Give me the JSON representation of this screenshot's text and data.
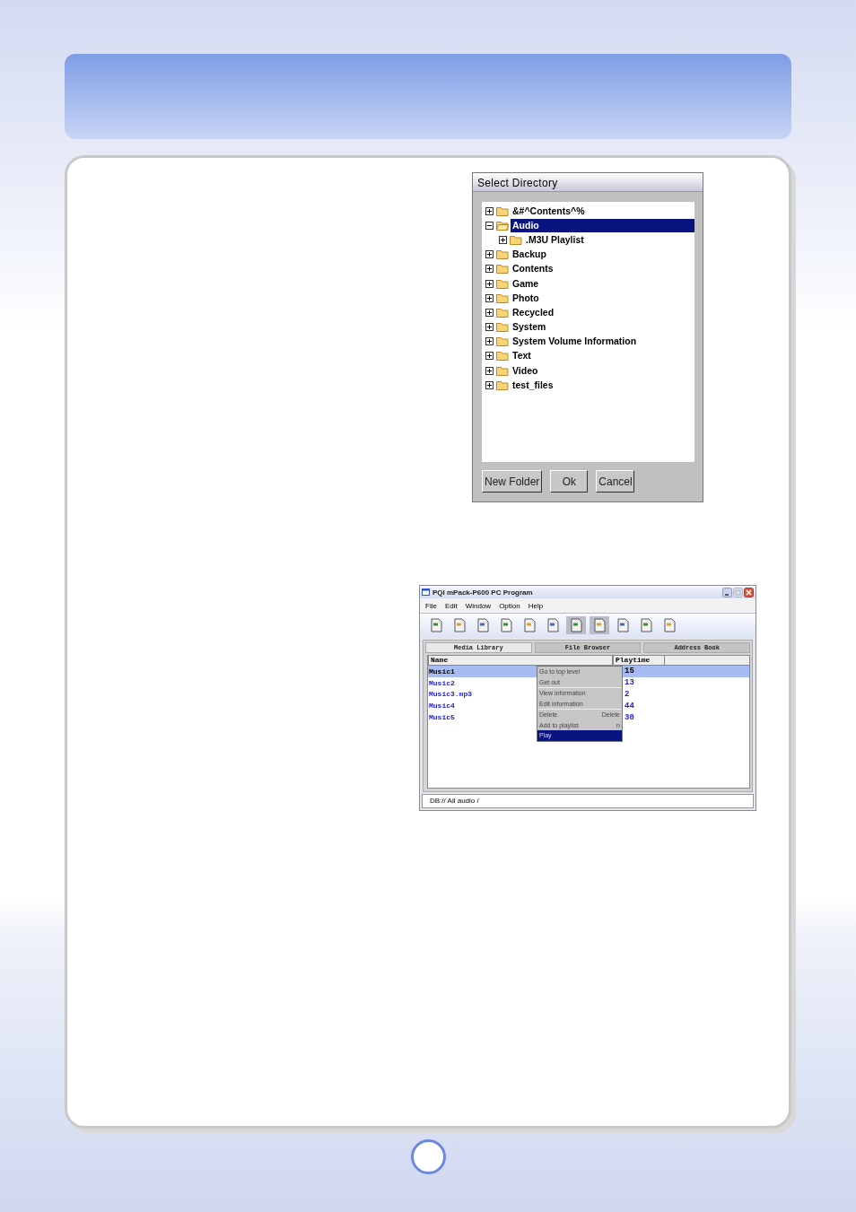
{
  "dialog": {
    "title": "Select Directory",
    "tree": [
      {
        "label": "&#^Contents^%",
        "expanded": false,
        "selected": false
      },
      {
        "label": "Audio",
        "expanded": true,
        "selected": true,
        "children": [
          {
            "label": ".M3U Playlist",
            "expanded": false,
            "selected": false
          }
        ]
      },
      {
        "label": "Backup",
        "expanded": false,
        "selected": false
      },
      {
        "label": "Contents",
        "expanded": false,
        "selected": false
      },
      {
        "label": "Game",
        "expanded": false,
        "selected": false
      },
      {
        "label": "Photo",
        "expanded": false,
        "selected": false
      },
      {
        "label": "Recycled",
        "expanded": false,
        "selected": false
      },
      {
        "label": "System",
        "expanded": false,
        "selected": false
      },
      {
        "label": "System Volume Information",
        "expanded": false,
        "selected": false
      },
      {
        "label": "Text",
        "expanded": false,
        "selected": false
      },
      {
        "label": "Video",
        "expanded": false,
        "selected": false
      },
      {
        "label": "test_files",
        "expanded": false,
        "selected": false
      }
    ],
    "buttons": [
      "New Folder",
      "Ok",
      "Cancel"
    ]
  },
  "app": {
    "title": "PQI mPack-P600 PC Program",
    "menu": [
      "File",
      "Edit",
      "Window",
      "Option",
      "Help"
    ],
    "toolbar": [
      {
        "pressed": false
      },
      {
        "pressed": false
      },
      {
        "pressed": false
      },
      {
        "pressed": false
      },
      {
        "pressed": false
      },
      {
        "pressed": false
      },
      {
        "pressed": true
      },
      {
        "pressed": true
      },
      {
        "pressed": false
      },
      {
        "pressed": false
      },
      {
        "pressed": false
      }
    ],
    "tabs": [
      {
        "label": "Media Library",
        "selected": true
      },
      {
        "label": "File Browser",
        "selected": false
      },
      {
        "label": "Address Book",
        "selected": false
      }
    ],
    "table": {
      "columns": [
        "Name",
        "Playtime"
      ],
      "rows": [
        {
          "name": "Music1",
          "playtime": "15",
          "selected": true
        },
        {
          "name": "Music2",
          "playtime": "13",
          "selected": false
        },
        {
          "name": "Music3.mp3",
          "playtime": "2",
          "selected": false
        },
        {
          "name": "Music4",
          "playtime": "44",
          "selected": false
        },
        {
          "name": "Music5",
          "playtime": "30",
          "selected": false
        }
      ]
    },
    "context_menu": [
      [
        {
          "label": "Go to top level",
          "selected": false
        },
        {
          "label": "Get out",
          "selected": false
        }
      ],
      [
        {
          "label": "View information",
          "selected": false
        },
        {
          "label": "Edit information",
          "selected": false
        }
      ],
      [
        {
          "label": "Delete",
          "shortcut": "Delete",
          "selected": false
        },
        {
          "label": "Add to playlist",
          "shortcut": "n",
          "selected": false
        },
        {
          "label": "Play",
          "selected": true
        }
      ]
    ],
    "status_bar": "DB:// All audio /"
  }
}
